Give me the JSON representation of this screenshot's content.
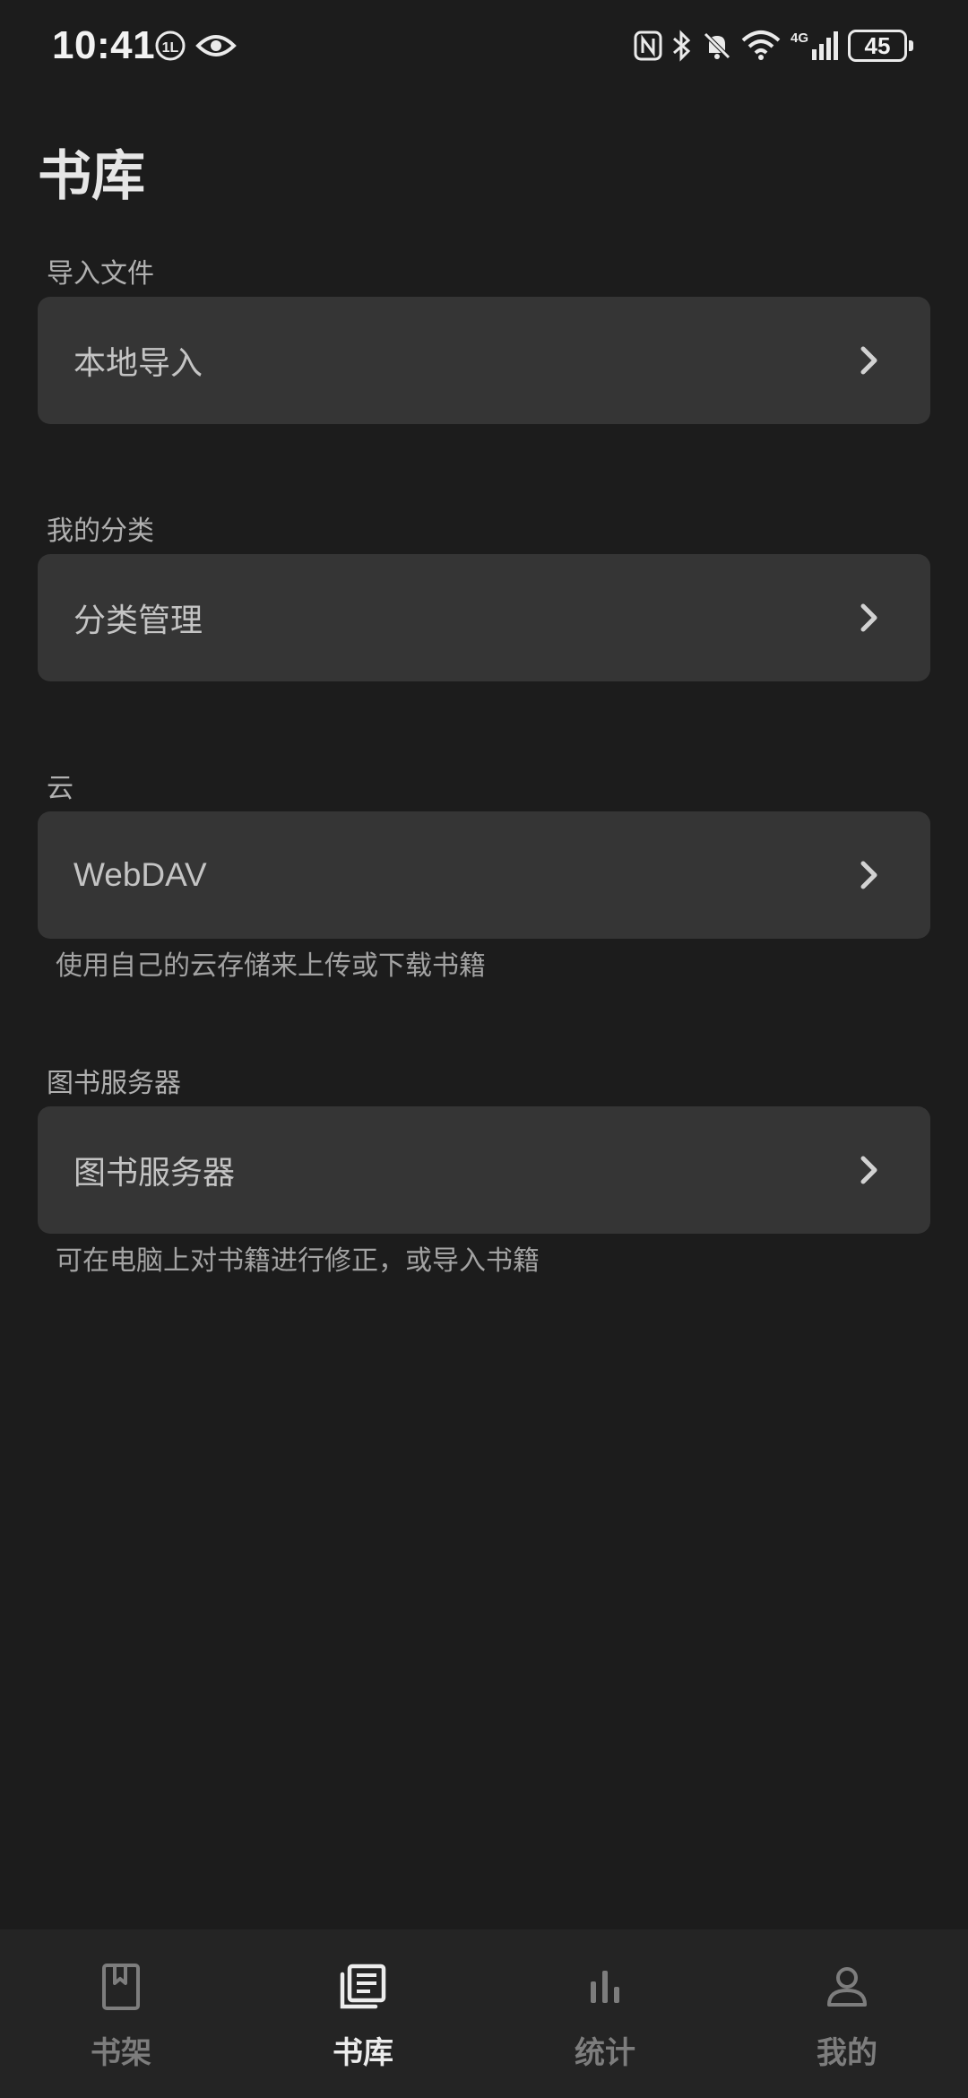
{
  "status_bar": {
    "time": "10:41",
    "battery": "45",
    "icons": [
      "data-saver-icon",
      "eye-icon",
      "nfc-icon",
      "bluetooth-icon",
      "bell-muted-icon",
      "wifi-icon",
      "signal-4g-icon",
      "battery-icon"
    ]
  },
  "page": {
    "title": "书库"
  },
  "sections": [
    {
      "header": "导入文件",
      "item_label": "本地导入",
      "description": ""
    },
    {
      "header": "我的分类",
      "item_label": "分类管理",
      "description": ""
    },
    {
      "header": "云",
      "item_label": "WebDAV",
      "description": "使用自己的云存储来上传或下载书籍"
    },
    {
      "header": "图书服务器",
      "item_label": "图书服务器",
      "description": "可在电脑上对书籍进行修正，或导入书籍"
    }
  ],
  "bottom_nav": {
    "items": [
      {
        "label": "书架",
        "icon": "bookshelf-icon",
        "active": false
      },
      {
        "label": "书库",
        "icon": "library-icon",
        "active": true
      },
      {
        "label": "统计",
        "icon": "stats-icon",
        "active": false
      },
      {
        "label": "我的",
        "icon": "profile-icon",
        "active": false
      }
    ]
  },
  "colors": {
    "background": "#1c1c1c",
    "card": "#353535",
    "nav_background": "#242424",
    "active_text": "#ececec",
    "inactive_text": "#7d7d7d"
  }
}
